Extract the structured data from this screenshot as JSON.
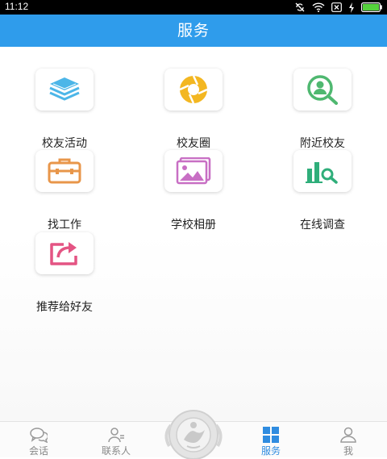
{
  "status_bar": {
    "time": "11:12"
  },
  "header": {
    "title": "服务"
  },
  "services": [
    {
      "label": "校友活动",
      "icon": "layers-icon"
    },
    {
      "label": "校友圈",
      "icon": "camera-aperture-icon"
    },
    {
      "label": "附近校友",
      "icon": "person-search-icon"
    },
    {
      "label": "找工作",
      "icon": "briefcase-icon"
    },
    {
      "label": "学校相册",
      "icon": "photo-album-icon"
    },
    {
      "label": "在线调查",
      "icon": "chart-search-icon"
    },
    {
      "label": "推荐给好友",
      "icon": "share-icon"
    }
  ],
  "tabs": [
    {
      "label": "会话",
      "icon": "chat-bubbles-icon",
      "active": false
    },
    {
      "label": "联系人",
      "icon": "contacts-icon",
      "active": false
    },
    {
      "label": "服务",
      "icon": "grid-icon",
      "active": true
    },
    {
      "label": "我",
      "icon": "person-icon",
      "active": false
    }
  ],
  "colors": {
    "brand": "#2f9ceb",
    "active_tab": "#2f8ce0",
    "inactive_tab": "#888888"
  }
}
